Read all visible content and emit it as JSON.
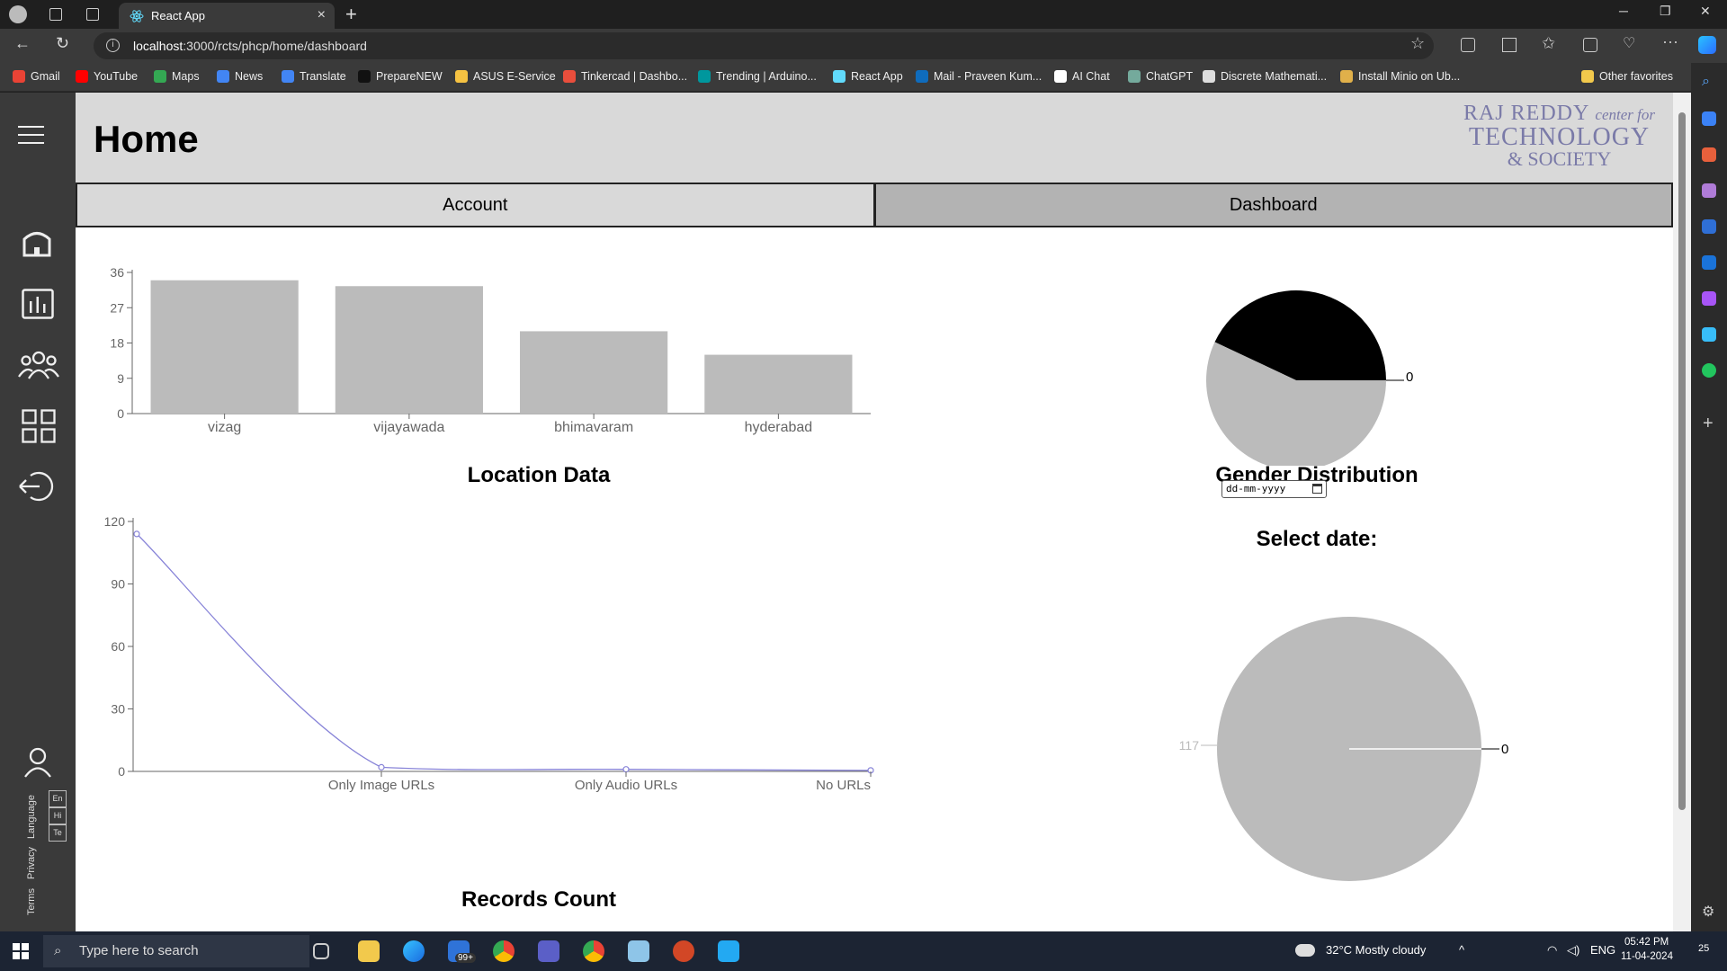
{
  "browser": {
    "tab_title": "React App",
    "url_host": "localhost",
    "url_rest": ":3000/rcts/phcp/home/dashboard",
    "bookmarks": [
      {
        "label": "Gmail",
        "color": "#ea4335"
      },
      {
        "label": "YouTube",
        "color": "#ff0000"
      },
      {
        "label": "Maps",
        "color": "#34a853"
      },
      {
        "label": "News",
        "color": "#4285f4"
      },
      {
        "label": "Translate",
        "color": "#4285f4"
      },
      {
        "label": "PrepareNEW",
        "color": "#111111"
      },
      {
        "label": "ASUS E-Service",
        "color": "#f5c242"
      },
      {
        "label": "Tinkercad | Dashbo...",
        "color": "#e94e3c"
      },
      {
        "label": "Trending | Arduino...",
        "color": "#00979d"
      },
      {
        "label": "React App",
        "color": "#61dafb"
      },
      {
        "label": "Mail - Praveen Kum...",
        "color": "#0f6cbd"
      },
      {
        "label": "AI Chat",
        "color": "#ffffff"
      },
      {
        "label": "ChatGPT",
        "color": "#74aa9c"
      },
      {
        "label": "Discrete Mathemati...",
        "color": "#dddddd"
      },
      {
        "label": "Install Minio on Ub...",
        "color": "#e0b04a"
      }
    ],
    "other_favorites": "Other favorites"
  },
  "app": {
    "page_title": "Home",
    "brand": {
      "line1": "RAJ REDDY",
      "line1_italic": "center for",
      "line2": "TECHNOLOGY",
      "line3": "& SOCIETY"
    },
    "tabs": [
      {
        "label": "Account"
      },
      {
        "label": "Dashboard"
      }
    ],
    "sidebar": {
      "language_label": "Language",
      "languages": [
        "En",
        "Hi",
        "Te"
      ],
      "privacy": "Privacy",
      "terms": "Terms"
    },
    "date_picker": {
      "label": "Select date:",
      "placeholder": "dd-mm-yyyy"
    }
  },
  "chart_data": [
    {
      "type": "bar",
      "title": "Location Data",
      "categories": [
        "vizag",
        "vijayawada",
        "bhimavaram",
        "hyderabad"
      ],
      "values": [
        34,
        32.5,
        21,
        15
      ],
      "ylim": [
        0,
        36
      ],
      "yticks": [
        0,
        9,
        18,
        27,
        36
      ],
      "color": "#bbbbbb"
    },
    {
      "type": "pie",
      "title": "Gender Distribution",
      "slices": [
        {
          "value": 43,
          "color": "#000000"
        },
        {
          "value": 57,
          "color": "#bbbbbb"
        }
      ],
      "labels": [
        "0"
      ]
    },
    {
      "type": "line",
      "title": "Records Count",
      "categories": [
        "",
        "Only Image URLs",
        "Only Audio URLs",
        "No URLs"
      ],
      "values": [
        114,
        2,
        1,
        0.5
      ],
      "ylim": [
        0,
        120
      ],
      "yticks": [
        0,
        30,
        60,
        90,
        120
      ],
      "color": "#8884d8"
    },
    {
      "type": "pie",
      "title": "",
      "slices": [
        {
          "value": 117,
          "color": "#bbbbbb"
        },
        {
          "value": 0,
          "color": "#ffffff"
        }
      ],
      "labels": [
        "117",
        "0"
      ]
    }
  ],
  "taskbar": {
    "search_placeholder": "Type here to search",
    "badge": "99+",
    "weather": "32°C  Mostly cloudy",
    "lang": "ENG",
    "time": "05:42 PM",
    "date": "11-04-2024",
    "notif": "25"
  }
}
